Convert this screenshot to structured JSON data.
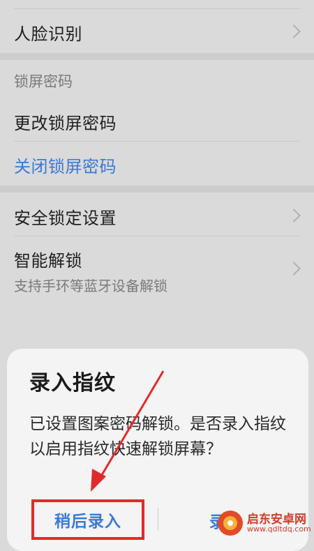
{
  "settings": {
    "face_recognition": "人脸识别",
    "lock_screen_header": "锁屏密码",
    "change_password": "更改锁屏密码",
    "close_password": "关闭锁屏密码",
    "security_lock_settings": "安全锁定设置",
    "smart_unlock": "智能解锁",
    "smart_unlock_desc": "支持手环等蓝牙设备解锁"
  },
  "dialog": {
    "title": "录入指纹",
    "message": "已设置图案密码解锁。是否录入指纹以启用指纹快速解锁屏幕？",
    "later_button": "稍后录入",
    "enter_button": "录"
  },
  "watermark": {
    "name": "启东安卓网",
    "url": "www.qdltdq.com"
  },
  "colors": {
    "accent": "#3a79d6",
    "annotation": "#e22a2a",
    "background": "#dadada",
    "dialog": "#f4f4f4"
  }
}
